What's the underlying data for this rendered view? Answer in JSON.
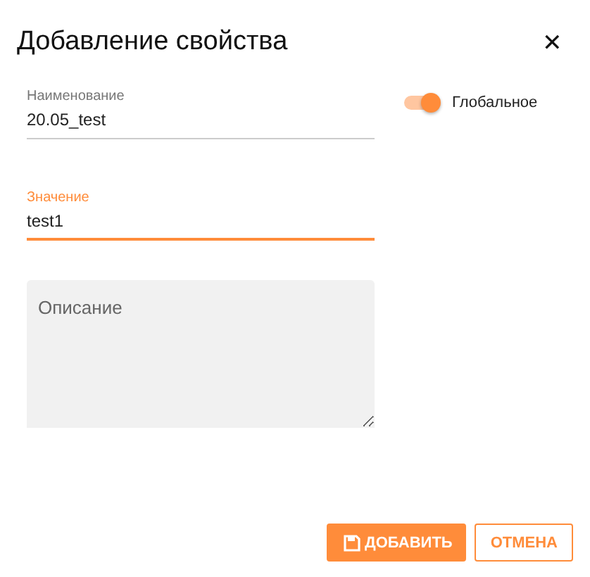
{
  "dialog": {
    "title": "Добавление свойства",
    "close": "✕"
  },
  "fields": [
    {
      "label": "Наименование",
      "value": "20.05_test",
      "focused": false
    },
    {
      "label": "Значение",
      "value": "test1",
      "focused": true
    }
  ],
  "global_toggle": {
    "label": "Глобальное",
    "on": true
  },
  "description": {
    "placeholder": "Описание"
  },
  "buttons": [
    {
      "label": "ДОБАВИТЬ",
      "kind": "primary"
    },
    {
      "label": "ОТМЕНА",
      "kind": "secondary"
    }
  ]
}
